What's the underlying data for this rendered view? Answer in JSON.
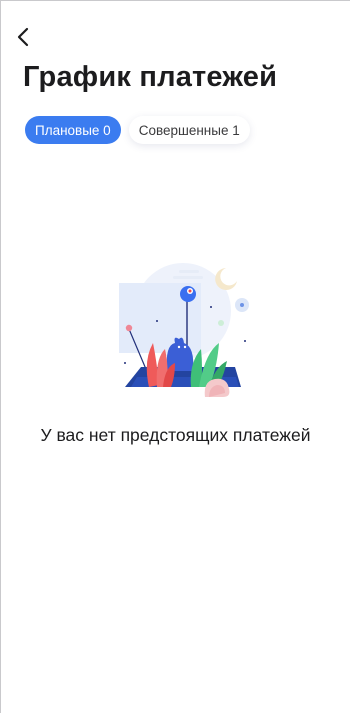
{
  "header": {
    "back_icon": "chevron-left-icon",
    "title": "График платежей"
  },
  "tabs": [
    {
      "label": "Плановые 0",
      "active": true
    },
    {
      "label": "Совершенные 1",
      "active": false
    }
  ],
  "empty_state": {
    "message": "У вас нет предстоящих платежей",
    "illustration_icon": "empty-schedule-illustration"
  },
  "colors": {
    "accent": "#3b7cf0",
    "text": "#1c1c1e"
  }
}
